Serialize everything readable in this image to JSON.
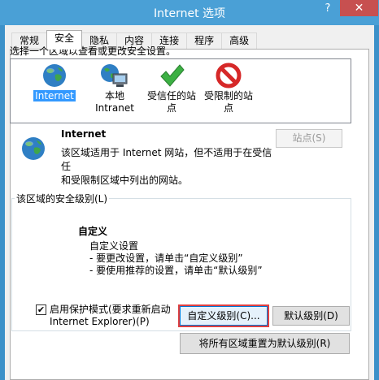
{
  "window": {
    "title": "Internet 选项",
    "help_glyph": "?",
    "close_glyph": "✕"
  },
  "tabs": [
    {
      "label": "常规",
      "active": false
    },
    {
      "label": "安全",
      "active": true
    },
    {
      "label": "隐私",
      "active": false
    },
    {
      "label": "内容",
      "active": false
    },
    {
      "label": "连接",
      "active": false
    },
    {
      "label": "程序",
      "active": false
    },
    {
      "label": "高级",
      "active": false
    }
  ],
  "security": {
    "prompt": "选择一个区域以查看或更改安全设置。",
    "zones": [
      {
        "label": "Internet",
        "icon": "globe-icon",
        "selected": true
      },
      {
        "label_line1": "本地",
        "label_line2": "Intranet",
        "icon": "intranet-icon"
      },
      {
        "label_line1": "受信任的站",
        "label_line2": "点",
        "icon": "checkmark-icon"
      },
      {
        "label_line1": "受限制的站",
        "label_line2": "点",
        "icon": "no-entry-icon"
      }
    ],
    "zone_name": "Internet",
    "zone_desc_line1": "该区域适用于 Internet 网站，但不适用于在受信任",
    "zone_desc_line2": "和受限制区域中列出的网站。",
    "sites_button": "站点(S)",
    "level_title": "该区域的安全级别(L)",
    "level_name": "自定义",
    "level_desc": [
      "自定义设置",
      "- 要更改设置，请单击“自定义级别”",
      "- 要使用推荐的设置，请单击“默认级别”"
    ],
    "protected_mode_line1": "启用保护模式(要求重新启动",
    "protected_mode_line2": "Internet Explorer)(P)",
    "protected_mode_checked": true,
    "check_glyph": "✔",
    "custom_level_button": "自定义级别(C)...",
    "default_level_button": "默认级别(D)",
    "reset_all_button": "将所有区域重置为默认级别(R)"
  },
  "colors": {
    "titlebar": "#4aa0d6",
    "close": "#c75050",
    "selection": "#3399ff",
    "highlight_border": "#e04040"
  }
}
